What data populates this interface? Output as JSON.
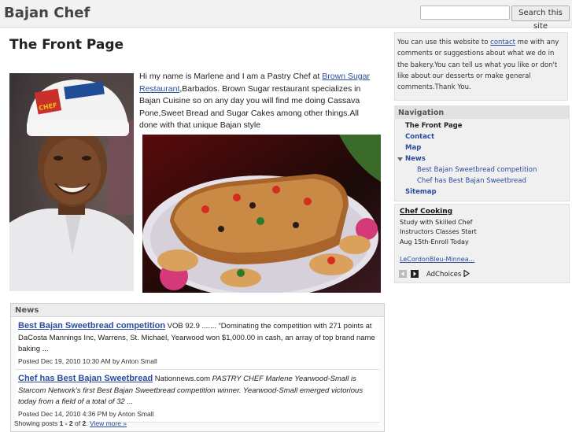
{
  "header": {
    "site_title": "Bajan Chef",
    "search_placeholder": "",
    "search_button": "Search this site"
  },
  "main": {
    "page_title": "The Front Page",
    "intro": {
      "part1": "Hi my name is Marlene and I am a Pastry Chef at ",
      "link": "Brown Sugar Restaurant",
      "part2": ",Barbados.  Brown Sugar restaurant specializes in Bajan Cuisine so on any day you will find me doing Cassava Pone,Sweet Bread and Sugar Cakes among other things.All done with that unique Bajan style"
    }
  },
  "news": {
    "header": "News",
    "items": [
      {
        "title": "Best Bajan Sweetbread competition",
        "source": " VOB 92.9",
        "snippet": " ....... “Dominating the competition with 271 points at DaCosta Mannings Inc, Warrens, St. Michael, Yearwood won $1,000.00 in cash, an array of top brand name baking ...",
        "posted": "Posted Dec 19, 2010 10:30 AM by Anton Small"
      },
      {
        "title": "Chef has Best Bajan Sweetbread",
        "source": " Nationnews.com",
        "snippet": "  PASTRY CHEF Marlene Yearwood-Small is Starcom Network’s first Best Bajan Sweetbread competition winner. Yearwood-Small emerged victorious today from a field of a total of 32 ...",
        "posted": "Posted Dec 14, 2010 4:36 PM by Anton Small"
      }
    ],
    "footer_prefix": "Showing posts ",
    "footer_range": "1 - 2",
    "footer_of": " of ",
    "footer_total": "2",
    "footer_suffix": ". ",
    "view_more": "View more »"
  },
  "sidebar": {
    "contact_text1": "You can use this website to ",
    "contact_link": "contact",
    "contact_text2": " me with any comments or suggestions about what we do in the bakery.You can tell us what you like or don't like about our desserts or make general comments.Thank You.",
    "nav_header": "Navigation",
    "nav_items": [
      {
        "label": "The Front Page"
      },
      {
        "label": "Contact"
      },
      {
        "label": "Map"
      },
      {
        "label": "News"
      },
      {
        "label": "Best Bajan Sweetbread competition"
      },
      {
        "label": "Chef has Best Bajan Sweetbread"
      },
      {
        "label": "Sitemap"
      }
    ],
    "ad": {
      "title": "Chef Cooking",
      "text": "Study with Skilled Chef Instructors Classes Start Aug 15th-Enroll Today",
      "link": "LeCordonBleu-Minnea...",
      "adchoices": "AdChoices"
    }
  },
  "colors": {
    "link": "#2a4c9c",
    "topbar": "#f2f2f2",
    "sidebar_bg": "#f0f0f0"
  }
}
